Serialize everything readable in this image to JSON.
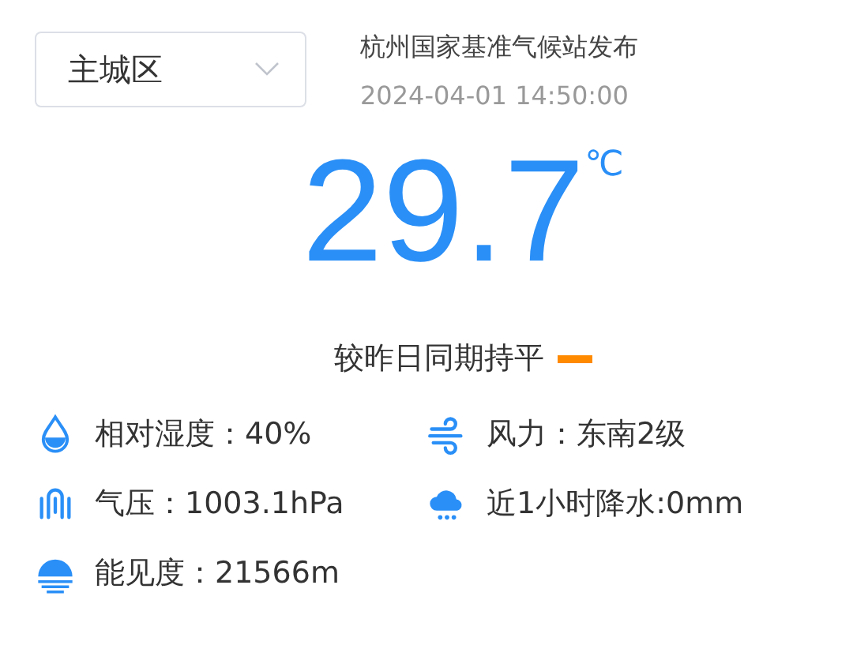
{
  "district_select": {
    "value": "主城区"
  },
  "source": "杭州国家基准气候站发布",
  "timestamp": "2024-04-01 14:50:00",
  "temperature": {
    "value": "29.7",
    "unit": "℃"
  },
  "comparison": {
    "text": "较昨日同期持平",
    "kind": "flat"
  },
  "stats": [
    {
      "kind": "humidity",
      "text": "相对湿度：40%"
    },
    {
      "kind": "wind",
      "text": "风力：东南2级"
    },
    {
      "kind": "pressure",
      "text": "气压：1003.1hPa"
    },
    {
      "kind": "rain",
      "text": "近1小时降水:0mm"
    },
    {
      "kind": "visibility",
      "text": "能见度：21566m"
    }
  ]
}
